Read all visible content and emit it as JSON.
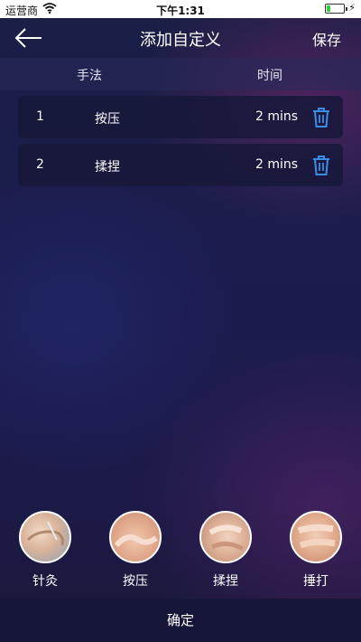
{
  "status_bar": {
    "carrier": "运营商",
    "time": "下午1:31",
    "battery_level": 0.2
  },
  "nav": {
    "title": "添加自定义",
    "save_label": "保存"
  },
  "table_header": {
    "technique": "手法",
    "time": "时间"
  },
  "rows": [
    {
      "index": "1",
      "name": "按压",
      "duration": "2 mins"
    },
    {
      "index": "2",
      "name": "揉捏",
      "duration": "2 mins"
    }
  ],
  "techniques": [
    {
      "label": "针灸"
    },
    {
      "label": "按压"
    },
    {
      "label": "揉捏"
    },
    {
      "label": "捶打"
    }
  ],
  "confirm_label": "确定",
  "colors": {
    "accent_blue": "#3a8ee6",
    "bottom_bar": "#16163a"
  }
}
